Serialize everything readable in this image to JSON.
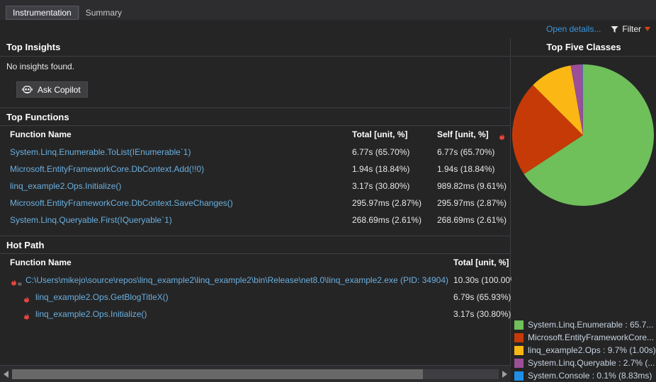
{
  "tabs": [
    {
      "label": "Instrumentation",
      "active": true
    },
    {
      "label": "Summary",
      "active": false
    }
  ],
  "commandbar": {
    "open_details": "Open details...",
    "filter_label": "Filter",
    "funnel_icon": "funnel-icon",
    "caret_icon": "chevron-down-icon"
  },
  "top_insights": {
    "title": "Top Insights",
    "message": "No insights found.",
    "copilot_button": "Ask Copilot",
    "copilot_icon": "copilot-icon"
  },
  "top_functions": {
    "title": "Top Functions",
    "columns": {
      "name": "Function Name",
      "total": "Total [unit, %]",
      "self": "Self [unit, %]"
    },
    "self_flame_icon": "flame-icon",
    "rows": [
      {
        "name": "System.Linq.Enumerable.ToList(IEnumerable`1)",
        "total": "6.77s (65.70%)",
        "self": "6.77s (65.70%)"
      },
      {
        "name": "Microsoft.EntityFrameworkCore.DbContext.Add(!!0)",
        "total": "1.94s (18.84%)",
        "self": "1.94s (18.84%)"
      },
      {
        "name": "linq_example2.Ops.Initialize()",
        "total": "3.17s (30.80%)",
        "self": "989.82ms (9.61%)"
      },
      {
        "name": "Microsoft.EntityFrameworkCore.DbContext.SaveChanges()",
        "total": "295.97ms (2.87%)",
        "self": "295.97ms (2.87%)"
      },
      {
        "name": "System.Linq.Queryable.First(IQueryable`1)",
        "total": "268.69ms (2.61%)",
        "self": "268.69ms (2.61%)"
      }
    ]
  },
  "hot_path": {
    "title": "Hot Path",
    "columns": {
      "name": "Function Name",
      "total": "Total [unit, %]"
    },
    "rows": [
      {
        "name": "C:\\Users\\mikejo\\source\\repos\\linq_example2\\linq_example2\\bin\\Release\\net8.0\\linq_example2.exe (PID: 34904)",
        "total": "10.30s (100.00%",
        "indent": 0,
        "icon": "flame-root-icon"
      },
      {
        "name": "linq_example2.Ops.GetBlogTitleX()",
        "total": "6.79s (65.93%)",
        "indent": 1,
        "icon": "flame-icon"
      },
      {
        "name": "linq_example2.Ops.Initialize()",
        "total": "3.17s (30.80%)",
        "indent": 1,
        "icon": "flame-icon"
      }
    ]
  },
  "scrollbar": {
    "left_arrow_icon": "caret-left-icon",
    "right_arrow_icon": "caret-right-icon"
  },
  "top_five_classes": {
    "title": "Top Five Classes",
    "legend": [
      {
        "label": "System.Linq.Enumerable : 65.7...",
        "color": "#6FBF5A"
      },
      {
        "label": "Microsoft.EntityFrameworkCore...",
        "color": "#C63A07"
      },
      {
        "label": "linq_example2.Ops : 9.7% (1.00s)",
        "color": "#FBB713"
      },
      {
        "label": "System.Linq.Queryable : 2.7% (...",
        "color": "#9B4F96"
      },
      {
        "label": "System.Console : 0.1% (8.83ms)",
        "color": "#1F8FE5"
      }
    ]
  },
  "chart_data": {
    "type": "pie",
    "title": "Top Five Classes",
    "labels": [
      "System.Linq.Enumerable",
      "Microsoft.EntityFrameworkCore",
      "linq_example2.Ops",
      "System.Linq.Queryable",
      "System.Console"
    ],
    "values": [
      65.7,
      21.8,
      9.7,
      2.7,
      0.1
    ],
    "colors": [
      "#6FBF5A",
      "#C63A07",
      "#FBB713",
      "#9B4F96",
      "#1F8FE5"
    ],
    "unit": "%",
    "start_angle_deg": 0,
    "direction": "clockwise",
    "legend_position": "bottom",
    "legend_labels": [
      "System.Linq.Enumerable : 65.7...",
      "Microsoft.EntityFrameworkCore...",
      "linq_example2.Ops : 9.7% (1.00s)",
      "System.Linq.Queryable : 2.7% (...",
      "System.Console : 0.1% (8.83ms)"
    ]
  }
}
